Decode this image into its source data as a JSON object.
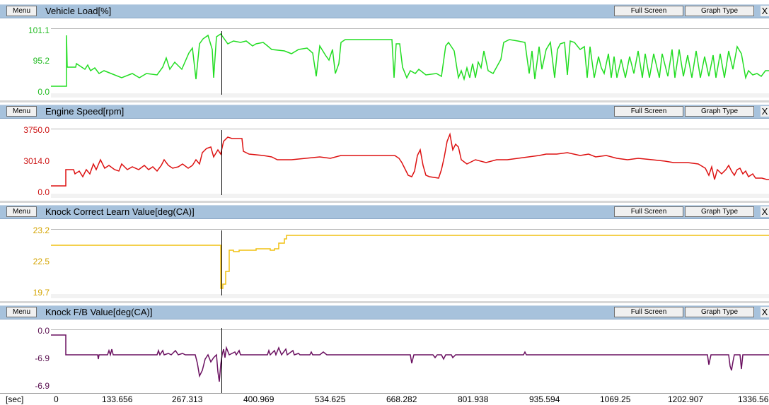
{
  "buttons": {
    "menu": "Menu",
    "full_screen": "Full Screen",
    "graph_type": "Graph Type",
    "close": "X"
  },
  "panels": [
    {
      "title": "Vehicle Load[%]",
      "color": "#22dd22",
      "y_ticks": [
        "101.1",
        "95.2",
        "0.0"
      ]
    },
    {
      "title": "Engine Speed[rpm]",
      "color": "#dd1111",
      "y_ticks": [
        "3750.0",
        "3014.0",
        "0.0"
      ]
    },
    {
      "title": "Knock Correct Learn Value[deg(CA)]",
      "color": "#f0c010",
      "y_ticks": [
        "23.2",
        "22.5",
        "19.7"
      ]
    },
    {
      "title": "Knock F/B Value[deg(CA)]",
      "color": "#6a1060",
      "y_ticks": [
        "0.0",
        "-6.9",
        "-6.9"
      ]
    }
  ],
  "x_axis": {
    "unit": "[sec]",
    "ticks": [
      "0",
      "133.656",
      "267.313",
      "400.969",
      "534.625",
      "668.282",
      "801.938",
      "935.594",
      "1069.25",
      "1202.907",
      "1336.56"
    ]
  }
}
